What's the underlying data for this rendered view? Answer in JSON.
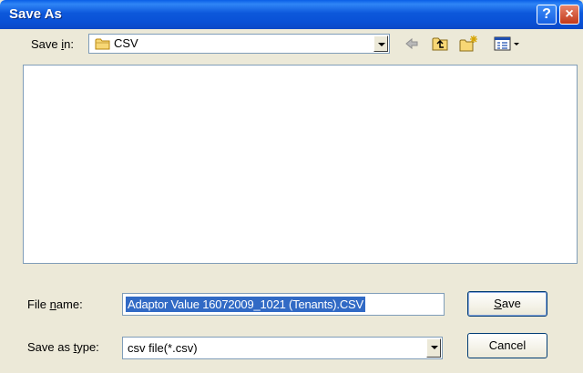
{
  "window": {
    "title": "Save As"
  },
  "titlebar": {
    "help_glyph": "?",
    "close_glyph": "×"
  },
  "toolbar": {
    "save_in_label_pre": "Save ",
    "save_in_label_accel": "i",
    "save_in_label_post": "n:",
    "save_in_value": "CSV",
    "icons": [
      "back-arrow-icon",
      "up-folder-icon",
      "new-folder-icon",
      "view-menu-icon"
    ]
  },
  "filename": {
    "label_pre": "File ",
    "label_accel": "n",
    "label_post": "ame:",
    "value": "Adaptor Value 16072009_1021 (Tenants).CSV"
  },
  "filetype": {
    "label_pre": "Save as ",
    "label_accel": "t",
    "label_post": "ype:",
    "value": "csv file(*.csv)"
  },
  "buttons": {
    "save_accel": "S",
    "save_rest": "ave",
    "cancel": "Cancel"
  },
  "colors": {
    "titlebar": "#0a54dc",
    "dialog_bg": "#ece9d8",
    "selection": "#316ac5",
    "close_red": "#c2391a"
  }
}
